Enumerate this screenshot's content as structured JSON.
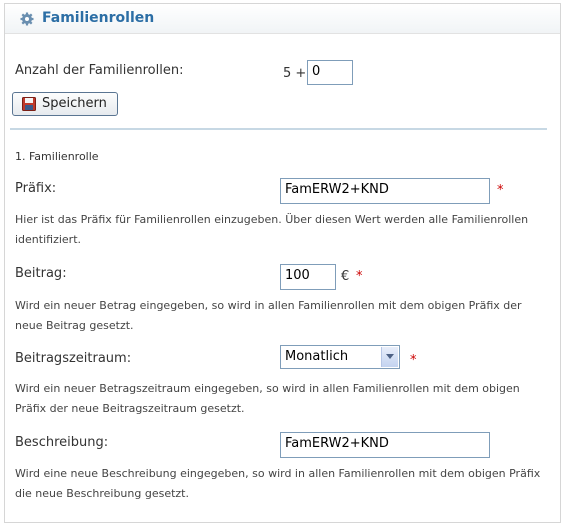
{
  "header": {
    "title": "Familienrollen",
    "icon": "gear-icon"
  },
  "count": {
    "label": "Anzahl der Familienrollen:",
    "prefix": "5 +",
    "value": "0"
  },
  "save_button": {
    "label": "Speichern",
    "icon": "floppy-disk-icon"
  },
  "section": {
    "title": "1. Familienrolle"
  },
  "fields": {
    "praefix": {
      "label": "Präfix:",
      "value": "FamERW2+KND",
      "required": "*",
      "help": "Hier ist das Präfix für Familienrollen einzugeben. Über diesen Wert werden alle Familienrollen identifiziert."
    },
    "beitrag": {
      "label": "Beitrag:",
      "value": "100",
      "unit": "€",
      "required": "*",
      "help": "Wird ein neuer Betrag eingegeben, so wird in allen Familienrollen mit dem obigen Präfix der neue Beitrag gesetzt."
    },
    "zeitraum": {
      "label": "Beitragszeitraum:",
      "value": "Monatlich",
      "required": "*",
      "help": "Wird ein neuer Betragszeitraum eingegeben, so wird in allen Familienrollen mit dem obigen Präfix der neue Beitragszeitraum gesetzt."
    },
    "beschreibung": {
      "label": "Beschreibung:",
      "value": "FamERW2+KND",
      "help": "Wird eine neue Beschreibung eingegeben, so wird in allen Familienrollen mit dem obigen Präfix die neue Beschreibung gesetzt."
    }
  },
  "colors": {
    "title": "#2c6ea5",
    "required": "#cc0000",
    "divider": "#c7d8e4"
  }
}
